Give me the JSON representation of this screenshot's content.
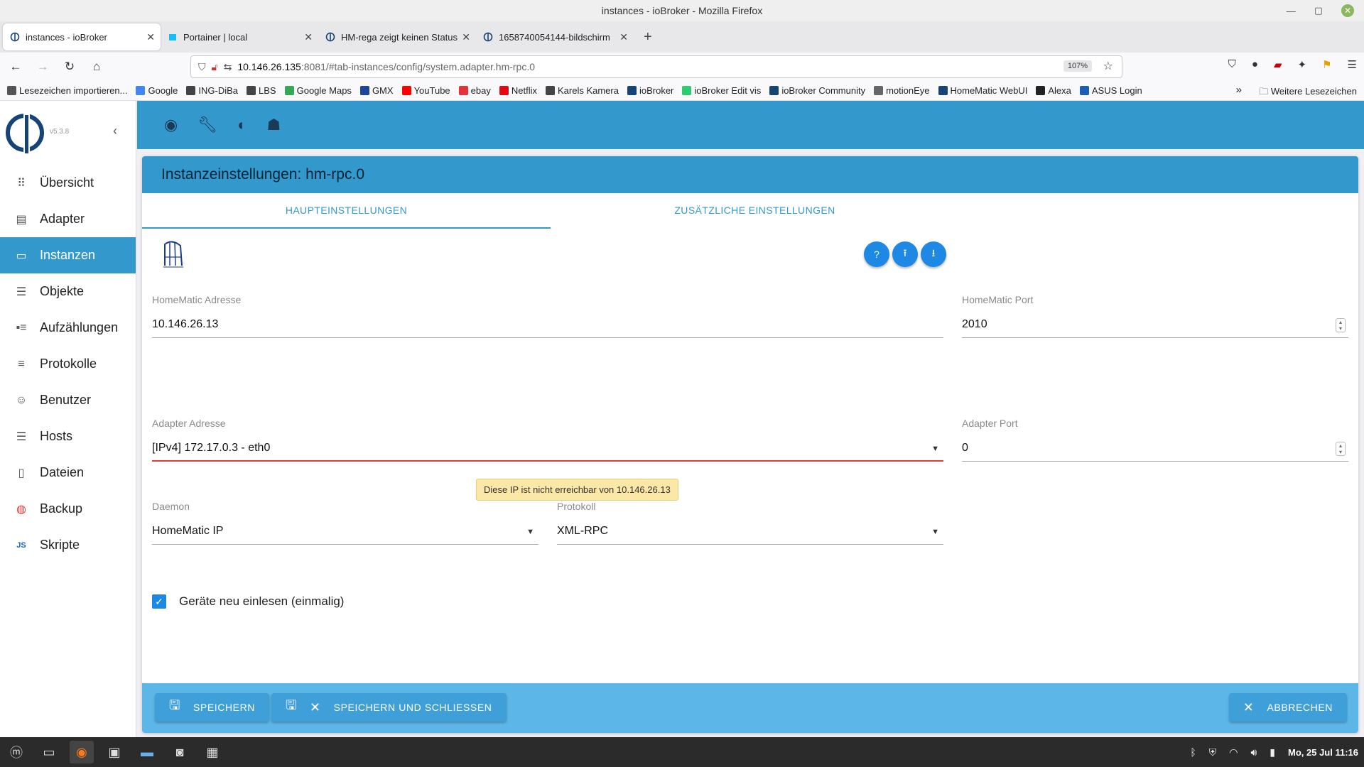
{
  "window": {
    "title": "instances - ioBroker - Mozilla Firefox"
  },
  "tabs": [
    {
      "label": "instances - ioBroker",
      "icon": "iobroker-icon"
    },
    {
      "label": "Portainer | local",
      "icon": "portainer-icon"
    },
    {
      "label": "HM-rega zeigt keinen Status",
      "icon": "iobroker-icon"
    },
    {
      "label": "1658740054144-bildschirm",
      "icon": "iobroker-icon"
    }
  ],
  "url": {
    "host": "10.146.26.135",
    "rest": ":8081/#tab-instances/config/system.adapter.hm-rpc.0",
    "zoom": "107%"
  },
  "bookmarks": [
    {
      "label": "Lesezeichen importieren...",
      "color": "#555555"
    },
    {
      "label": "Google",
      "color": "#4285f4"
    },
    {
      "label": "ING-DiBa",
      "color": "#444444"
    },
    {
      "label": "LBS",
      "color": "#444444"
    },
    {
      "label": "Google Maps",
      "color": "#34a853"
    },
    {
      "label": "GMX",
      "color": "#1c449b"
    },
    {
      "label": "YouTube",
      "color": "#ff0000"
    },
    {
      "label": "ebay",
      "color": "#e53238"
    },
    {
      "label": "Netflix",
      "color": "#e50914"
    },
    {
      "label": "Karels Kamera",
      "color": "#444444"
    },
    {
      "label": "ioBroker",
      "color": "#164477"
    },
    {
      "label": "ioBroker Edit vis",
      "color": "#2ecc71"
    },
    {
      "label": "ioBroker Community",
      "color": "#164477"
    },
    {
      "label": "motionEye",
      "color": "#666666"
    },
    {
      "label": "HomeMatic WebUI",
      "color": "#164477"
    },
    {
      "label": "Alexa",
      "color": "#222222"
    },
    {
      "label": "ASUS Login",
      "color": "#1a5fb4"
    }
  ],
  "bookmarks_more": "Weitere Lesezeichen",
  "sidebar": {
    "version": "v5.3.8",
    "items": [
      {
        "label": "Übersicht",
        "icon": "grid-icon"
      },
      {
        "label": "Adapter",
        "icon": "store-icon"
      },
      {
        "label": "Instanzen",
        "icon": "instances-icon",
        "active": true
      },
      {
        "label": "Objekte",
        "icon": "list-icon"
      },
      {
        "label": "Aufzählungen",
        "icon": "enum-icon"
      },
      {
        "label": "Protokolle",
        "icon": "log-icon"
      },
      {
        "label": "Benutzer",
        "icon": "user-icon"
      },
      {
        "label": "Hosts",
        "icon": "hosts-icon"
      },
      {
        "label": "Dateien",
        "icon": "files-icon"
      },
      {
        "label": "Backup",
        "icon": "backup-icon"
      },
      {
        "label": "Skripte",
        "icon": "js-icon"
      }
    ]
  },
  "page": {
    "title": "Instanzeinstellungen: hm-rpc.0",
    "tab_main": "HAUPTEINSTELLUNGEN",
    "tab_extra": "ZUSÄTZLICHE EINSTELLUNGEN",
    "homematic_address_label": "HomeMatic Adresse",
    "homematic_address": "10.146.26.13",
    "homematic_port_label": "HomeMatic Port",
    "homematic_port": "2010",
    "adapter_address_label": "Adapter Adresse",
    "adapter_address": "[IPv4] 172.17.0.3 - eth0",
    "adapter_port_label": "Adapter Port",
    "adapter_port": "0",
    "tooltip": "Diese IP ist nicht erreichbar von 10.146.26.13",
    "daemon_label": "Daemon",
    "daemon": "HomeMatic IP",
    "protocol_label": "Protokoll",
    "protocol": "XML-RPC",
    "reinit_label": "Geräte neu einlesen (einmalig)",
    "reinit_checked": true
  },
  "footer": {
    "save": "SPEICHERN",
    "save_close": "SPEICHERN UND SCHLIESSEN",
    "cancel": "ABBRECHEN"
  },
  "taskbar": {
    "clock": "Mo, 25 Jul 11:16"
  },
  "colors": {
    "accent": "#3399cc",
    "button": "#1e88e5",
    "error": "#e53935",
    "tooltip": "#fce8a6"
  }
}
